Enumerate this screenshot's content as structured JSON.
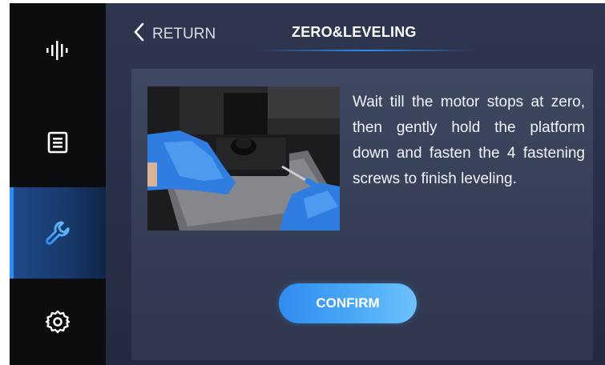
{
  "header": {
    "return_label": "RETURN",
    "title": "ZERO&LEVELING"
  },
  "sidebar": {
    "items": [
      {
        "icon": "waveform-icon",
        "active": false
      },
      {
        "icon": "file-list-icon",
        "active": false
      },
      {
        "icon": "wrench-icon",
        "active": true
      },
      {
        "icon": "gear-icon",
        "active": false
      }
    ]
  },
  "main": {
    "photo_icon": "leveling-photo",
    "instruction": "Wait till the motor stops at zero, then gently hold the platform down and fasten the 4 fastening screws to finish leveling.",
    "confirm_label": "CONFIRM"
  },
  "colors": {
    "accent": "#2e8df2",
    "sidebar_bg": "#0c0d11",
    "panel_bg": "#3a4460",
    "glove_blue": "#2f7de0"
  }
}
